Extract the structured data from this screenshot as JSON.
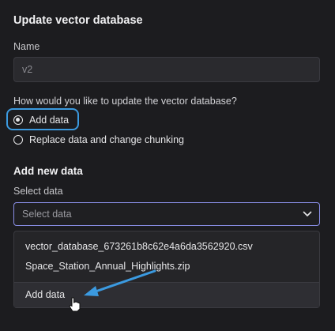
{
  "header": {
    "title": "Update vector database"
  },
  "name_field": {
    "label": "Name",
    "value": "v2"
  },
  "update_question": "How would you like to update the vector database?",
  "options": [
    {
      "label": "Add data",
      "selected": true
    },
    {
      "label": "Replace data and change chunking",
      "selected": false
    }
  ],
  "add_section": {
    "title": "Add new data",
    "select_label": "Select data",
    "select_placeholder": "Select data"
  },
  "dropdown": {
    "items": [
      "vector_database_673261b8c62e4a6da3562920.csv",
      "Space_Station_Annual_Highlights.zip"
    ],
    "action": "Add data"
  },
  "colors": {
    "background": "#1c1c1f",
    "highlight": "#3b9ae0",
    "focus_border": "#8a8fe8"
  },
  "icons": [
    "chevron-down-icon",
    "arrow-annotation-icon",
    "hand-cursor-icon"
  ]
}
